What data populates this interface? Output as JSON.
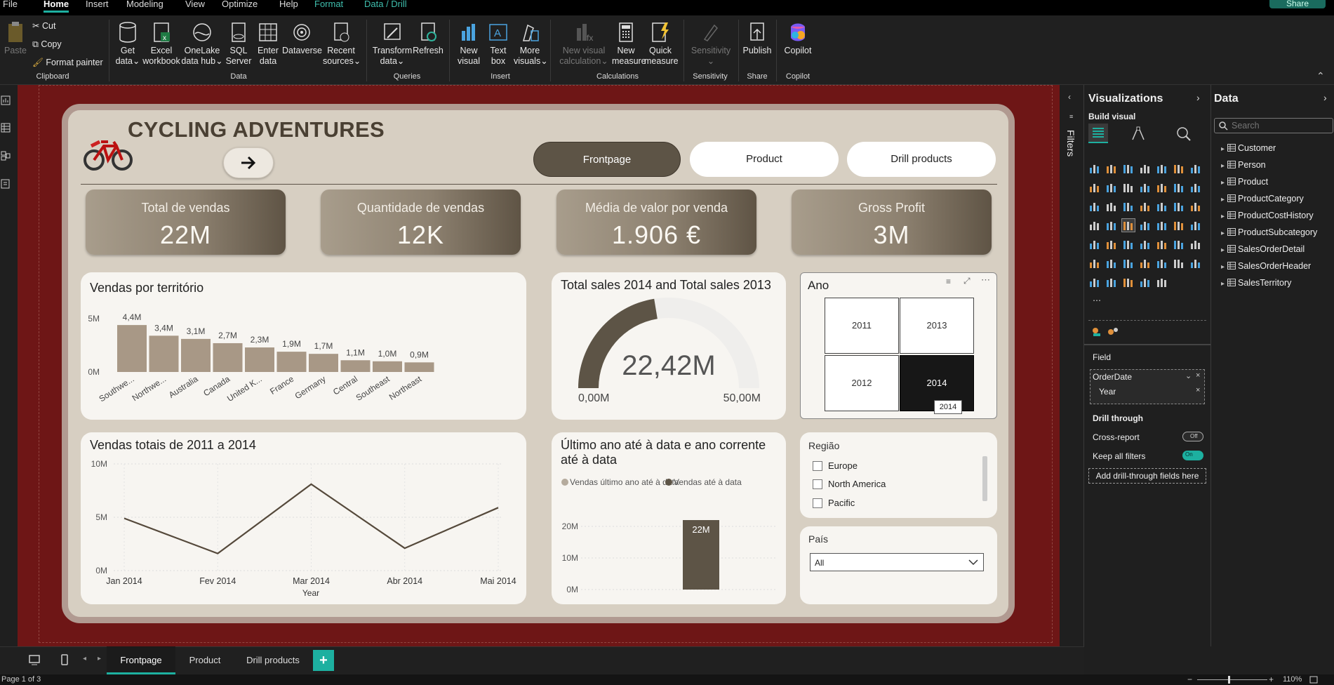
{
  "menu": {
    "items": [
      "File",
      "Home",
      "Insert",
      "Modeling",
      "View",
      "Optimize",
      "Help",
      "Format",
      "Data / Drill"
    ],
    "share": "Share"
  },
  "ribbon": {
    "clipboard": {
      "paste": "Paste",
      "cut": "Cut",
      "copy": "Copy",
      "format_painter": "Format painter",
      "label": "Clipboard"
    },
    "data": {
      "get_data": [
        "Get",
        "data"
      ],
      "excel": [
        "Excel",
        "workbook"
      ],
      "onelake": [
        "OneLake",
        "data hub"
      ],
      "sql": [
        "SQL",
        "Server"
      ],
      "enter": [
        "Enter",
        "data"
      ],
      "dataverse": "Dataverse",
      "recent": [
        "Recent",
        "sources"
      ],
      "label": "Data"
    },
    "queries": {
      "transform": [
        "Transform",
        "data"
      ],
      "refresh": "Refresh",
      "label": "Queries"
    },
    "insert": {
      "new_visual": [
        "New",
        "visual"
      ],
      "text_box": [
        "Text",
        "box"
      ],
      "more_visuals": [
        "More",
        "visuals"
      ],
      "label": "Insert"
    },
    "calculations": {
      "new_visual_calc": [
        "New visual",
        "calculation"
      ],
      "new_measure": [
        "New",
        "measure"
      ],
      "quick_measure": [
        "Quick",
        "measure"
      ],
      "label": "Calculations"
    },
    "sensitivity": {
      "btn": "Sensitivity",
      "label": "Sensitivity"
    },
    "share": {
      "publish": "Publish",
      "label": "Share"
    },
    "copilot": {
      "btn": "Copilot",
      "label": "Copilot"
    }
  },
  "report": {
    "title": "CYCLING ADVENTURES",
    "nav": {
      "frontpage": "Frontpage",
      "product": "Product",
      "drill": "Drill products"
    },
    "kpis": [
      {
        "label": "Total de vendas",
        "value": "22M"
      },
      {
        "label": "Quantidade de vendas",
        "value": "12K"
      },
      {
        "label": "Média de valor por venda",
        "value": "1.906 €"
      },
      {
        "label": "Gross Profit",
        "value": "3M"
      }
    ],
    "territory_title": "Vendas por território",
    "gauge_title": "Total sales 2014 and Total sales 2013",
    "ano_title": "Ano",
    "years": [
      "2011",
      "2013",
      "2012",
      "2014"
    ],
    "selected_year": "2014",
    "yearly_title": "Vendas totais de 2011 a 2014",
    "ytd_title_1": "Último ano até à data e ano corrente",
    "ytd_title_2": "até à data",
    "regiao_title": "Região",
    "regions": [
      "Europe",
      "North America",
      "Pacific"
    ],
    "pais_title": "País",
    "pais_value": "All"
  },
  "chart_data": [
    {
      "type": "bar",
      "title": "Vendas por território",
      "categories": [
        "Southwe...",
        "Northwe...",
        "Australia",
        "Canada",
        "United K...",
        "France",
        "Germany",
        "Central",
        "Southeast",
        "Northeast"
      ],
      "values": [
        4.4,
        3.4,
        3.1,
        2.7,
        2.3,
        1.9,
        1.7,
        1.1,
        1.0,
        0.9
      ],
      "data_labels": [
        "4,4M",
        "3,4M",
        "3,1M",
        "2,7M",
        "2,3M",
        "1,9M",
        "1,7M",
        "1,1M",
        "1,0M",
        "0,9M"
      ],
      "y_ticks": [
        "5M",
        "0M"
      ],
      "ylim": [
        0,
        5
      ]
    },
    {
      "type": "gauge",
      "title": "Total sales 2014 and Total sales 2013",
      "value": 22.42,
      "value_label": "22,42M",
      "min_label": "0,00M",
      "max_label": "50,00M",
      "range": [
        0,
        50
      ]
    },
    {
      "type": "line",
      "title": "Vendas totais de 2011 a 2014",
      "x": [
        "Jan 2014",
        "Fev 2014",
        "Mar 2014",
        "Abr 2014",
        "Mai 2014"
      ],
      "values": [
        4.9,
        1.6,
        8.1,
        2.1,
        5.9
      ],
      "xlabel": "Year",
      "y_ticks": [
        "10M",
        "5M",
        "0M"
      ],
      "ylim": [
        0,
        10
      ]
    },
    {
      "type": "bar",
      "title": "Último ano até à data e ano corrente até à data",
      "legend": [
        "Vendas último ano até à data",
        "Vendas até à data"
      ],
      "series": [
        {
          "name": "Vendas último ano até à data",
          "values": [
            0
          ]
        },
        {
          "name": "Vendas até à data",
          "values": [
            22
          ]
        }
      ],
      "data_labels": [
        "22M"
      ],
      "y_ticks": [
        "20M",
        "10M",
        "0M"
      ],
      "ylim": [
        0,
        22
      ]
    }
  ],
  "filters_label": "Filters",
  "viz_pane": {
    "title": "Visualizations",
    "build_visual": "Build visual",
    "field_label": "Field",
    "field_name": "OrderDate",
    "field_sub": "Year",
    "drill_through": "Drill through",
    "cross_report": "Cross-report",
    "cross_report_state": "Off",
    "keep_filters": "Keep all filters",
    "keep_filters_state": "On",
    "add_drill": "Add drill-through fields here"
  },
  "data_pane": {
    "title": "Data",
    "search_placeholder": "Search",
    "tables": [
      "Customer",
      "Person",
      "Product",
      "ProductCategory",
      "ProductCostHistory",
      "ProductSubcategory",
      "SalesOrderDetail",
      "SalesOrderHeader",
      "SalesTerritory"
    ]
  },
  "pages": {
    "tabs": [
      "Frontpage",
      "Product",
      "Drill products"
    ]
  },
  "status": {
    "page": "Page 1 of 3",
    "zoom": "110%"
  },
  "colors": {
    "accent": "#1db0a0",
    "canvas": "#6e1616",
    "report_bg": "#d7cfc2",
    "dark_brown": "#5d5446",
    "bar": "#a89886"
  }
}
